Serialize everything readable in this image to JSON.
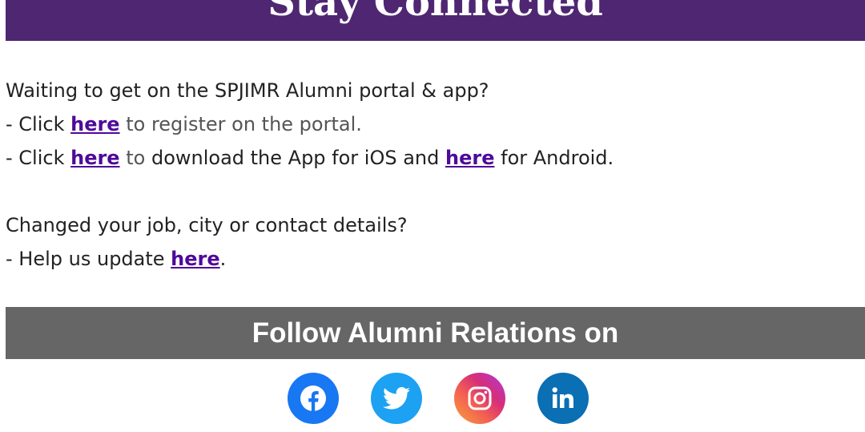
{
  "header": {
    "title": "Stay Connected"
  },
  "portal": {
    "question": "Waiting to get on the SPJIMR Alumni portal & app?",
    "register_prefix": " - Click ",
    "register_link": "here",
    "register_suffix": " to register on the portal.",
    "app_prefix": " - Click ",
    "app_ios_link": "here",
    "app_mid_to": " to",
    "app_mid": " download the App for iOS and ",
    "app_android_link": "here",
    "app_suffix": " for Android."
  },
  "update": {
    "question": "Changed your job, city or contact details?",
    "prefix": " - Help us update ",
    "link": "here",
    "suffix": "."
  },
  "follow": {
    "title": "Follow Alumni Relations on"
  },
  "social": [
    {
      "name": "Facebook",
      "icon": "facebook-icon",
      "color": "#1877f2"
    },
    {
      "name": "Twitter",
      "icon": "twitter-icon",
      "color": "#1da1f2"
    },
    {
      "name": "Instagram",
      "icon": "instagram-icon",
      "color": "#e1306c"
    },
    {
      "name": "LinkedIn",
      "icon": "linkedin-icon",
      "color": "#0a6fb3"
    }
  ],
  "colors": {
    "banner": "#4e2672",
    "link": "#4e0a9a",
    "follow_bar": "#666666"
  }
}
